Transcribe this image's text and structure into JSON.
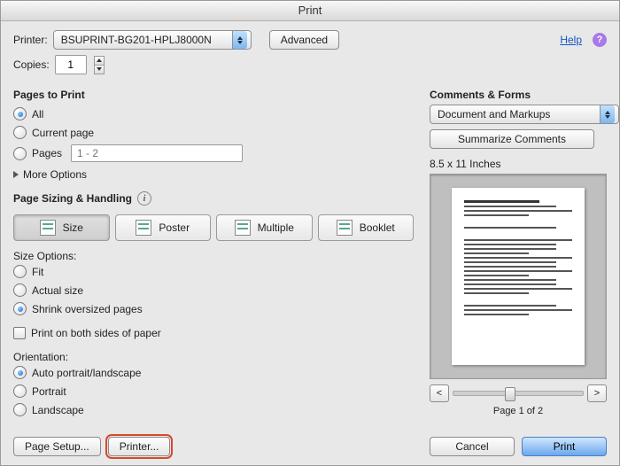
{
  "window": {
    "title": "Print"
  },
  "top": {
    "printer_label": "Printer:",
    "printer_value": "BSUPRINT-BG201-HPLJ8000N",
    "advanced_btn": "Advanced",
    "help_label": "Help",
    "copies_label": "Copies:",
    "copies_value": "1"
  },
  "pages": {
    "title": "Pages to Print",
    "all": "All",
    "current": "Current page",
    "pages": "Pages",
    "range_placeholder": "1 - 2",
    "more_options": "More Options"
  },
  "sizing": {
    "title": "Page Sizing & Handling",
    "size": "Size",
    "poster": "Poster",
    "multiple": "Multiple",
    "booklet": "Booklet",
    "options_title": "Size Options:",
    "fit": "Fit",
    "actual": "Actual size",
    "shrink": "Shrink oversized pages",
    "both_sides": "Print on both sides of paper"
  },
  "orientation": {
    "title": "Orientation:",
    "auto": "Auto portrait/landscape",
    "portrait": "Portrait",
    "landscape": "Landscape"
  },
  "comments": {
    "title": "Comments & Forms",
    "select_value": "Document and Markups",
    "summarize_btn": "Summarize Comments"
  },
  "preview": {
    "dimensions": "8.5 x 11 Inches",
    "prev": "<",
    "next": ">",
    "page_indicator": "Page 1 of 2"
  },
  "footer": {
    "page_setup": "Page Setup...",
    "printer_btn": "Printer...",
    "cancel": "Cancel",
    "print": "Print"
  }
}
